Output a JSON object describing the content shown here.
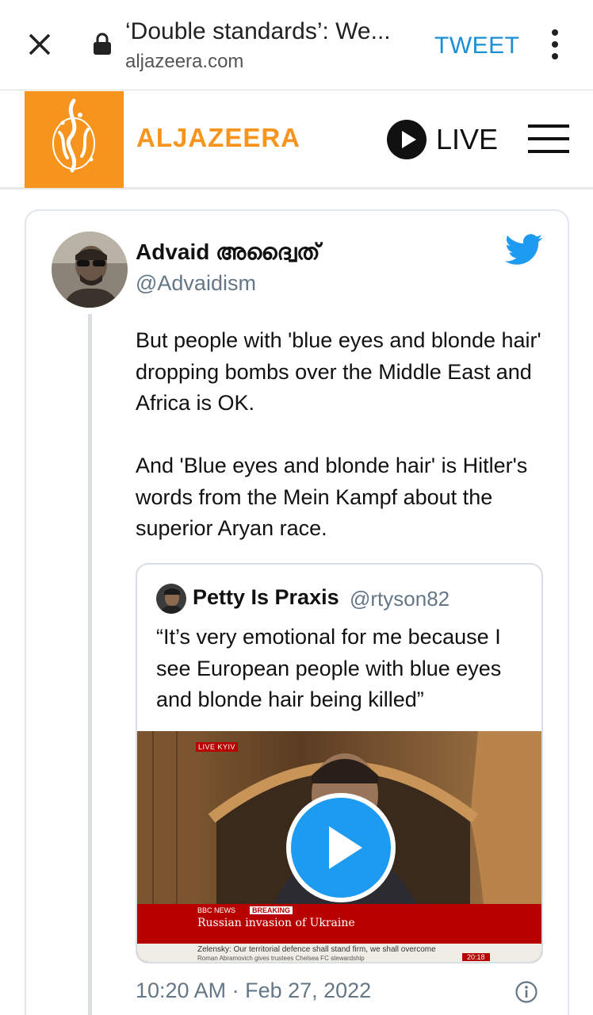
{
  "browser": {
    "page_title": "‘Double standards’: We...",
    "domain": "aljazeera.com",
    "tweet_label": "TWEET",
    "link_color": "#1a8fd6"
  },
  "site": {
    "brand": "ALJAZEERA",
    "brand_color": "#f7941d",
    "live_label": "LIVE"
  },
  "tweet": {
    "author_name": "Advaid അദ്വൈത്",
    "handle": "@Advaidism",
    "paragraphs": [
      "But people with 'blue eyes and blonde hair' dropping bombs over the Middle East and Africa is OK.",
      "And 'Blue eyes and blonde hair' is Hitler's words from the Mein Kampf about the superior Aryan race."
    ],
    "timestamp": "10:20 AM · Feb 27, 2022",
    "twitter_blue": "#1d9bf0"
  },
  "quoted_tweet": {
    "author_name": "Petty Is Praxis",
    "handle": "@rtyson82",
    "text": "“It’s very emotional for me because I see European people with blue eyes and blonde hair being killed”",
    "video": {
      "live_badge": "LIVE KYIV",
      "channel": "BBC NEWS",
      "breaking_label": "BREAKING",
      "headline": "Russian invasion of Ukraine",
      "subheadline": "Zelensky: Our territorial defence shall stand firm, we shall overcome",
      "ticker": "Roman Abramovich gives trustees Chelsea FC stewardship",
      "clock": "20:18"
    }
  }
}
